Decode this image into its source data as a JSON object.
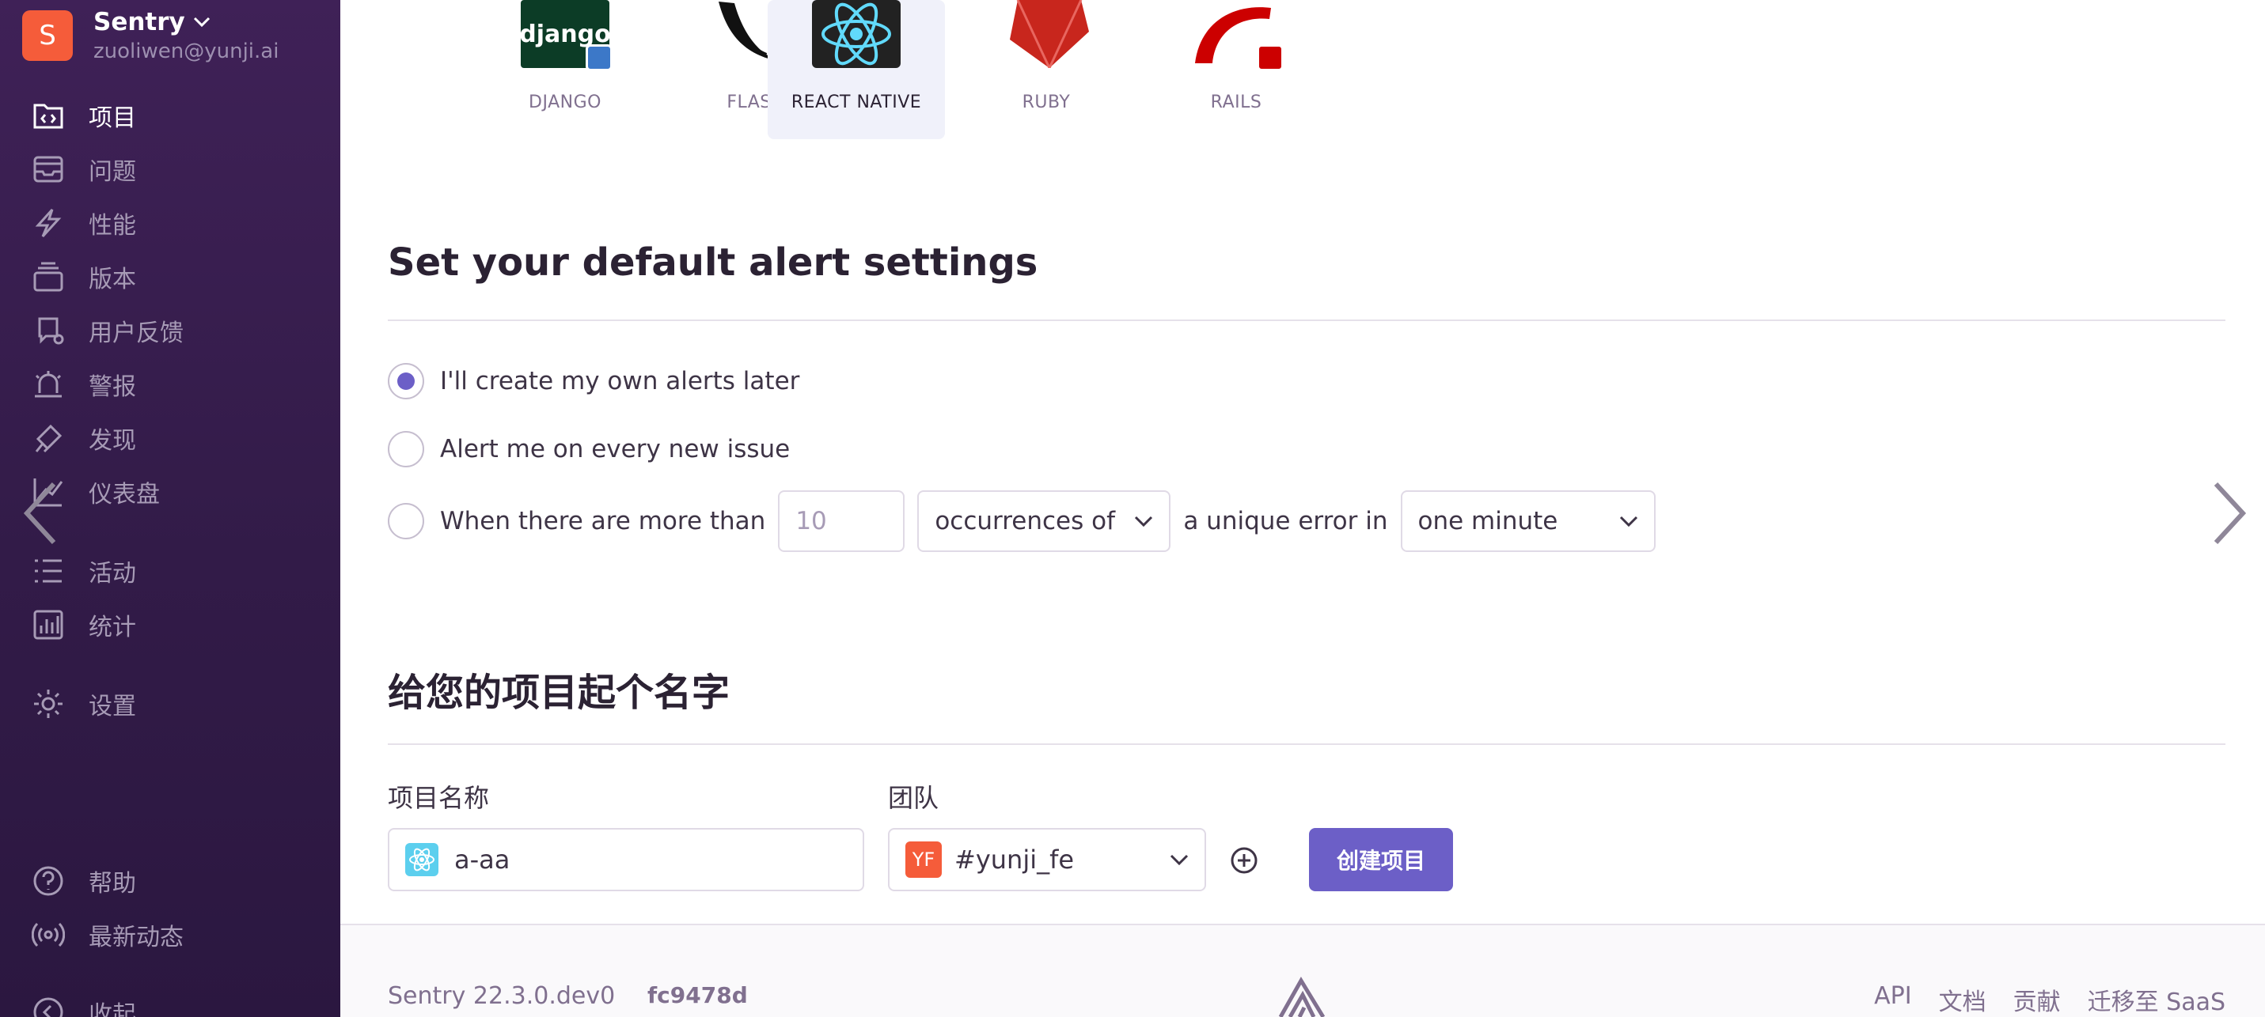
{
  "sidebar": {
    "org_name": "Sentry",
    "org_initial": "S",
    "user_email": "zuoliwen@yunji.ai",
    "items": [
      {
        "label": "项目",
        "icon": "projects-icon"
      },
      {
        "label": "问题",
        "icon": "issues-icon"
      },
      {
        "label": "性能",
        "icon": "performance-icon"
      },
      {
        "label": "版本",
        "icon": "releases-icon"
      },
      {
        "label": "用户反馈",
        "icon": "user-feedback-icon"
      },
      {
        "label": "警报",
        "icon": "alerts-icon"
      },
      {
        "label": "发现",
        "icon": "discover-icon"
      },
      {
        "label": "仪表盘",
        "icon": "dashboards-icon"
      },
      {
        "label": "活动",
        "icon": "activity-icon"
      },
      {
        "label": "统计",
        "icon": "stats-icon"
      },
      {
        "label": "设置",
        "icon": "settings-icon"
      }
    ],
    "bottom_items": [
      {
        "label": "帮助",
        "icon": "help-icon"
      },
      {
        "label": "最新动态",
        "icon": "broadcast-icon"
      },
      {
        "label": "收起",
        "icon": "collapse-icon"
      }
    ]
  },
  "platforms": [
    {
      "label": "DJANGO",
      "logo_text": "django"
    },
    {
      "label": "FLASK"
    },
    {
      "label": "REACT NATIVE",
      "selected": true
    },
    {
      "label": "RUBY"
    },
    {
      "label": "RAILS"
    }
  ],
  "alerts": {
    "title": "Set your default alert settings",
    "option1": "I'll create my own alerts later",
    "option2": "Alert me on every new issue",
    "option3_prefix": "When there are more than",
    "threshold_placeholder": "10",
    "metric_value": "occurrences of",
    "middle_text": "a unique error in",
    "interval_value": "one minute"
  },
  "project": {
    "title": "给您的项目起个名字",
    "name_label": "项目名称",
    "name_value": "a-aa",
    "team_label": "团队",
    "team_badge": "YF",
    "team_value": "#yunji_fe",
    "create_button": "创建项目"
  },
  "footer": {
    "version": "Sentry 22.3.0.dev0",
    "hash": "fc9478d",
    "links": [
      "API",
      "文档",
      "贡献",
      "迁移至 SaaS"
    ]
  },
  "colors": {
    "accent": "#6c5fc7",
    "sidebar_bg": "#3f2157",
    "org_avatar": "#f55c3a"
  }
}
